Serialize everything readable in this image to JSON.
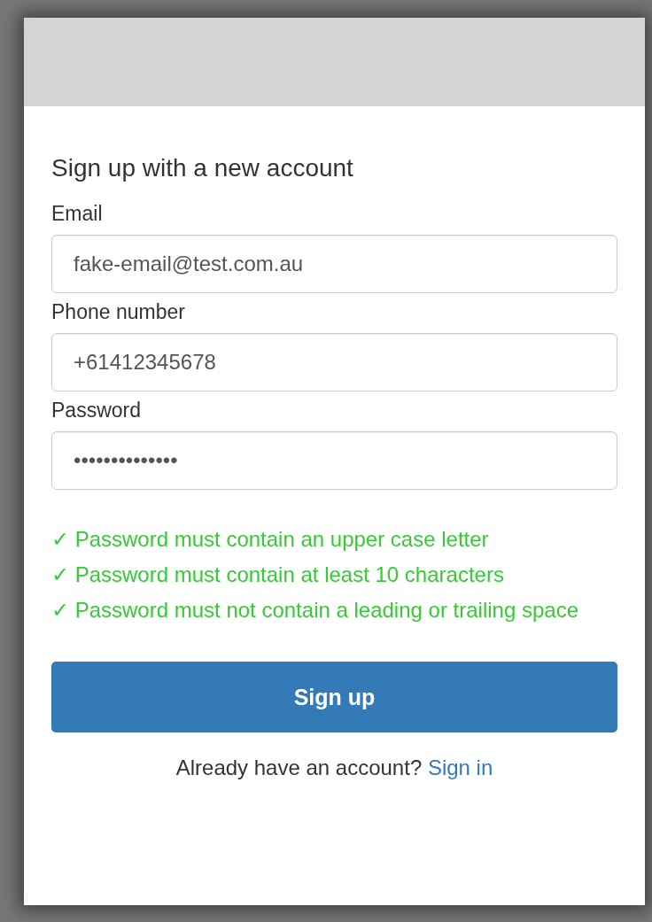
{
  "form": {
    "title": "Sign up with a new account",
    "fields": [
      {
        "label": "Email",
        "value": "fake-email@test.com.au"
      },
      {
        "label": "Phone number",
        "value": "+61412345678"
      },
      {
        "label": "Password",
        "value": "••••••••••••••"
      }
    ],
    "requirements": [
      {
        "text": "✓ Password must contain an upper case letter",
        "met": true
      },
      {
        "text": "✓ Password must contain at least 10 characters",
        "met": true
      },
      {
        "text": "✓ Password must not contain a leading or trailing space",
        "met": true
      }
    ],
    "submit": "Sign up",
    "footer": {
      "prompt": "Already have an account?",
      "link": "Sign in"
    }
  }
}
